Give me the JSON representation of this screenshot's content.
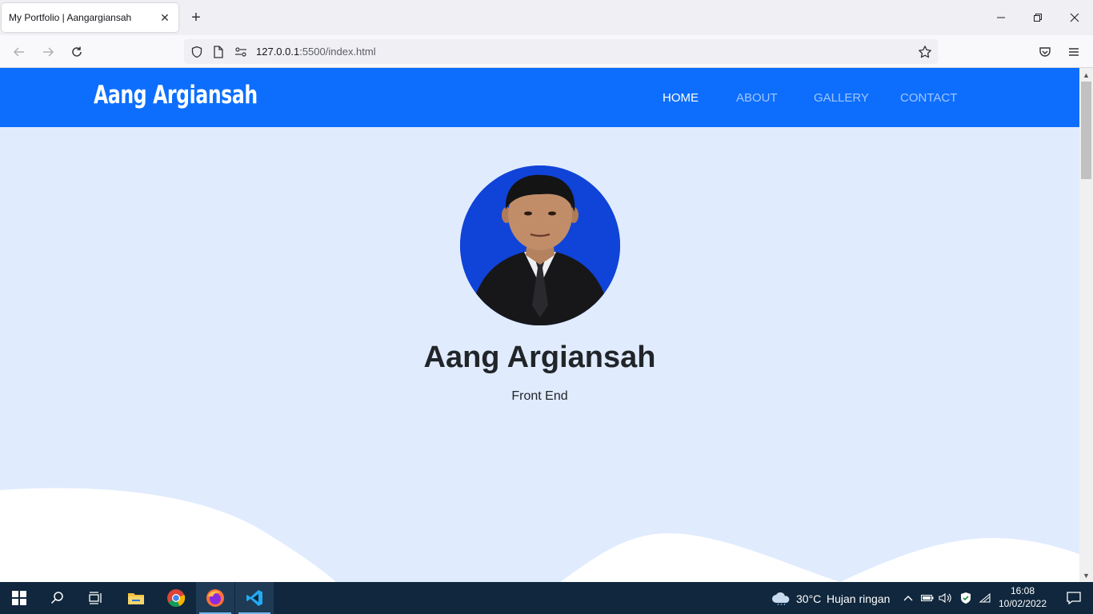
{
  "browser": {
    "tab_title": "My Portfolio | Aangargiansah",
    "url_host": "127.0.0.1",
    "url_rest": ":5500/index.html"
  },
  "site": {
    "brand": "Aang Argiansah",
    "menu": [
      "HOME",
      "ABOUT",
      "GALLERY",
      "CONTACT"
    ],
    "hero_name": "Aang Argiansah",
    "hero_role": "Front End"
  },
  "taskbar": {
    "temperature": "30°C",
    "weather": "Hujan ringan",
    "time": "16:08",
    "date": "10/02/2022"
  },
  "colors": {
    "nav_bg": "#0d6efd",
    "hero_bg": "#e0ebfe",
    "avatar_bg": "#1043d8",
    "taskbar_bg": "#10273d"
  }
}
